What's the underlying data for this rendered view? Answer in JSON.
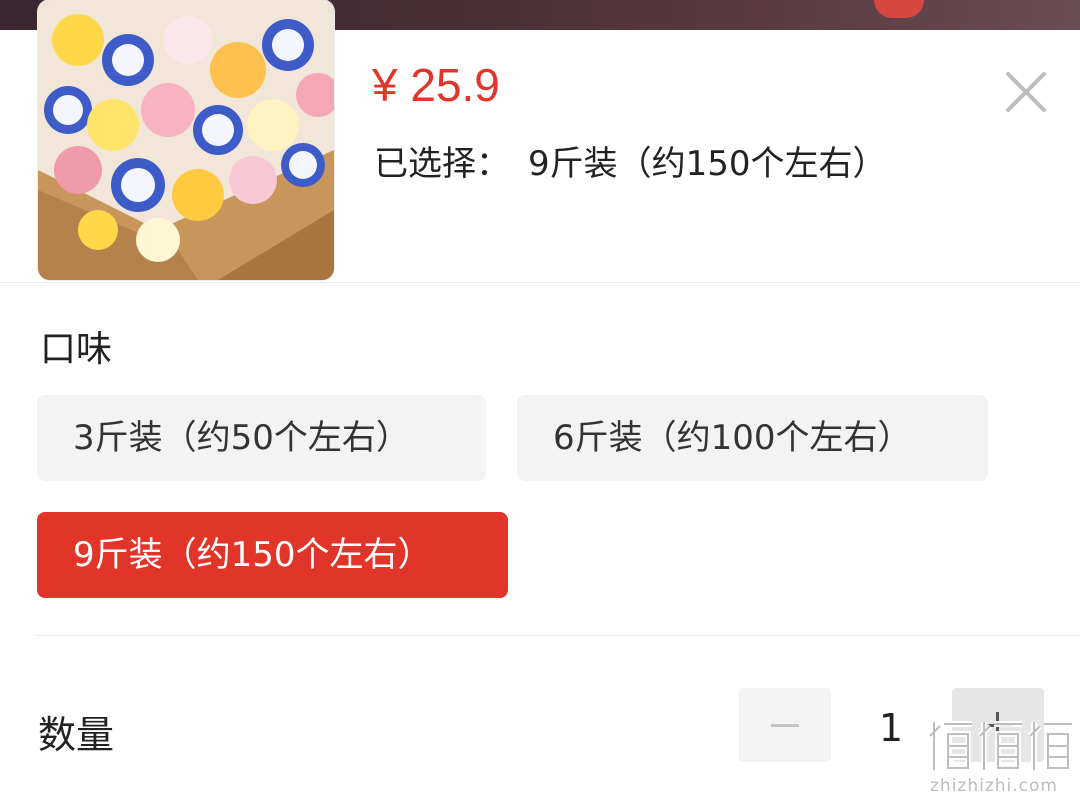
{
  "product": {
    "image_name": "jelly-cups-box-image",
    "price": "¥ 25.9"
  },
  "selection": {
    "label": "已选择：",
    "value": "9斤装（约150个左右）"
  },
  "flavor": {
    "title": "口味",
    "options": [
      {
        "label": "3斤装（约50个左右）",
        "selected": false
      },
      {
        "label": "6斤装（约100个左右）",
        "selected": false
      },
      {
        "label": "9斤装（约150个左右）",
        "selected": true
      }
    ]
  },
  "quantity": {
    "label": "数量",
    "value": "1"
  },
  "colors": {
    "accent": "#e1352a",
    "chip_bg": "#f3f3f3"
  },
  "watermark": {
    "text": "zhizhizhi.com"
  }
}
